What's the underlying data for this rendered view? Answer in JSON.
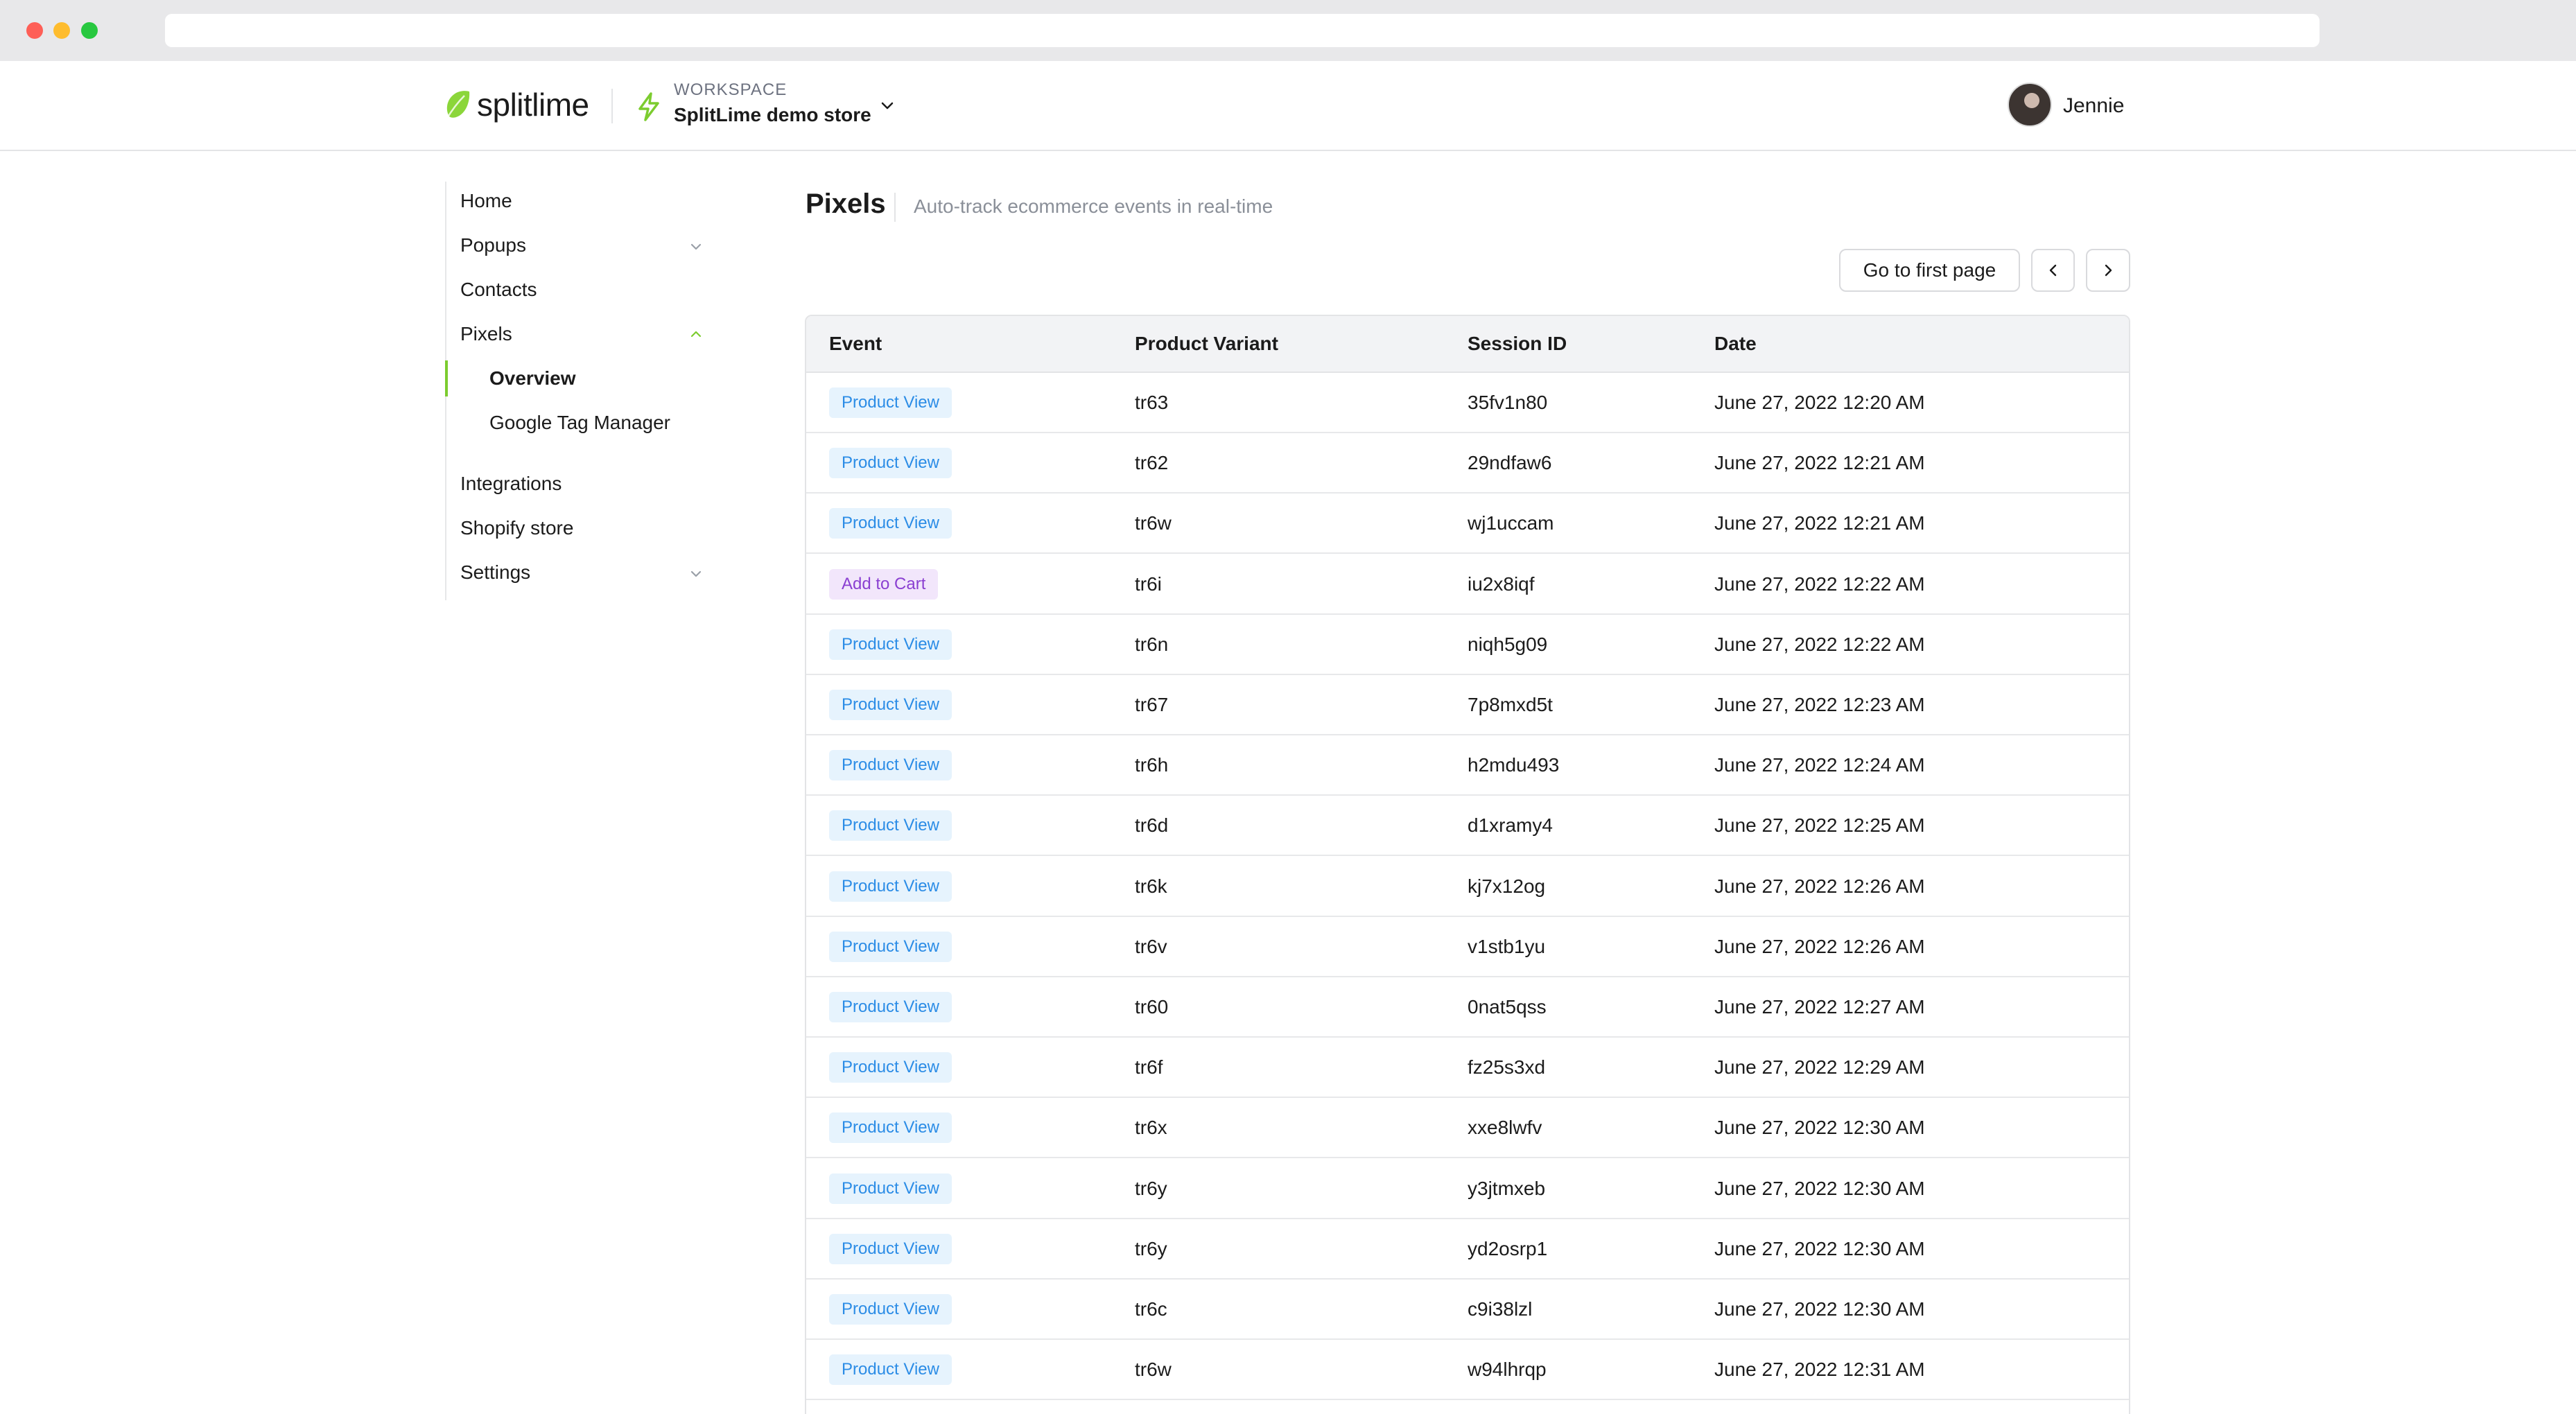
{
  "colors": {
    "accent": "#7ccc2f",
    "product_view_bg": "#e6f3fd",
    "product_view_text": "#2b8ce6",
    "add_to_cart_bg": "#f2e6fb",
    "add_to_cart_text": "#8a3fd1"
  },
  "header": {
    "logo_text": "splitlime",
    "workspace_label": "WORKSPACE",
    "workspace_name": "SplitLime demo store",
    "user_name": "Jennie"
  },
  "sidebar": {
    "items": [
      {
        "label": "Home"
      },
      {
        "label": "Popups",
        "icon": "chevron-down-icon"
      },
      {
        "label": "Contacts"
      },
      {
        "label": "Pixels",
        "icon": "chevron-up-icon"
      },
      {
        "label": "Overview",
        "sub": true,
        "active": true
      },
      {
        "label": "Google Tag Manager",
        "sub": true
      },
      {
        "label": "Integrations"
      },
      {
        "label": "Shopify store"
      },
      {
        "label": "Settings",
        "icon": "chevron-down-icon"
      }
    ]
  },
  "main": {
    "title": "Pixels",
    "subtitle": "Auto-track ecommerce events in real-time",
    "first_page_label": "Go to first page"
  },
  "table": {
    "columns": [
      "Event",
      "Product Variant",
      "Session ID",
      "Date"
    ],
    "rows": [
      {
        "event": "Product View",
        "type": "view",
        "variant": "tr63",
        "session": "35fv1n80",
        "date": "June 27, 2022 12:20 AM"
      },
      {
        "event": "Product View",
        "type": "view",
        "variant": "tr62",
        "session": "29ndfaw6",
        "date": "June 27, 2022 12:21 AM"
      },
      {
        "event": "Product View",
        "type": "view",
        "variant": "tr6w",
        "session": "wj1uccam",
        "date": "June 27, 2022 12:21 AM"
      },
      {
        "event": "Add to Cart",
        "type": "cart",
        "variant": "tr6i",
        "session": "iu2x8iqf",
        "date": "June 27, 2022 12:22 AM"
      },
      {
        "event": "Product View",
        "type": "view",
        "variant": "tr6n",
        "session": "niqh5g09",
        "date": "June 27, 2022 12:22 AM"
      },
      {
        "event": "Product View",
        "type": "view",
        "variant": "tr67",
        "session": "7p8mxd5t",
        "date": "June 27, 2022 12:23 AM"
      },
      {
        "event": "Product View",
        "type": "view",
        "variant": "tr6h",
        "session": "h2mdu493",
        "date": "June 27, 2022 12:24 AM"
      },
      {
        "event": "Product View",
        "type": "view",
        "variant": "tr6d",
        "session": "d1xramy4",
        "date": "June 27, 2022 12:25 AM"
      },
      {
        "event": "Product View",
        "type": "view",
        "variant": "tr6k",
        "session": "kj7x12og",
        "date": "June 27, 2022 12:26 AM"
      },
      {
        "event": "Product View",
        "type": "view",
        "variant": "tr6v",
        "session": "v1stb1yu",
        "date": "June 27, 2022 12:26 AM"
      },
      {
        "event": "Product View",
        "type": "view",
        "variant": "tr60",
        "session": "0nat5qss",
        "date": "June 27, 2022 12:27 AM"
      },
      {
        "event": "Product View",
        "type": "view",
        "variant": "tr6f",
        "session": "fz25s3xd",
        "date": "June 27, 2022 12:29 AM"
      },
      {
        "event": "Product View",
        "type": "view",
        "variant": "tr6x",
        "session": "xxe8lwfv",
        "date": "June 27, 2022 12:30 AM"
      },
      {
        "event": "Product View",
        "type": "view",
        "variant": "tr6y",
        "session": "y3jtmxeb",
        "date": "June 27, 2022 12:30 AM"
      },
      {
        "event": "Product View",
        "type": "view",
        "variant": "tr6y",
        "session": "yd2osrp1",
        "date": "June 27, 2022 12:30 AM"
      },
      {
        "event": "Product View",
        "type": "view",
        "variant": "tr6c",
        "session": "c9i38lzl",
        "date": "June 27, 2022 12:30 AM"
      },
      {
        "event": "Product View",
        "type": "view",
        "variant": "tr6w",
        "session": "w94lhrqp",
        "date": "June 27, 2022 12:31 AM"
      }
    ]
  }
}
